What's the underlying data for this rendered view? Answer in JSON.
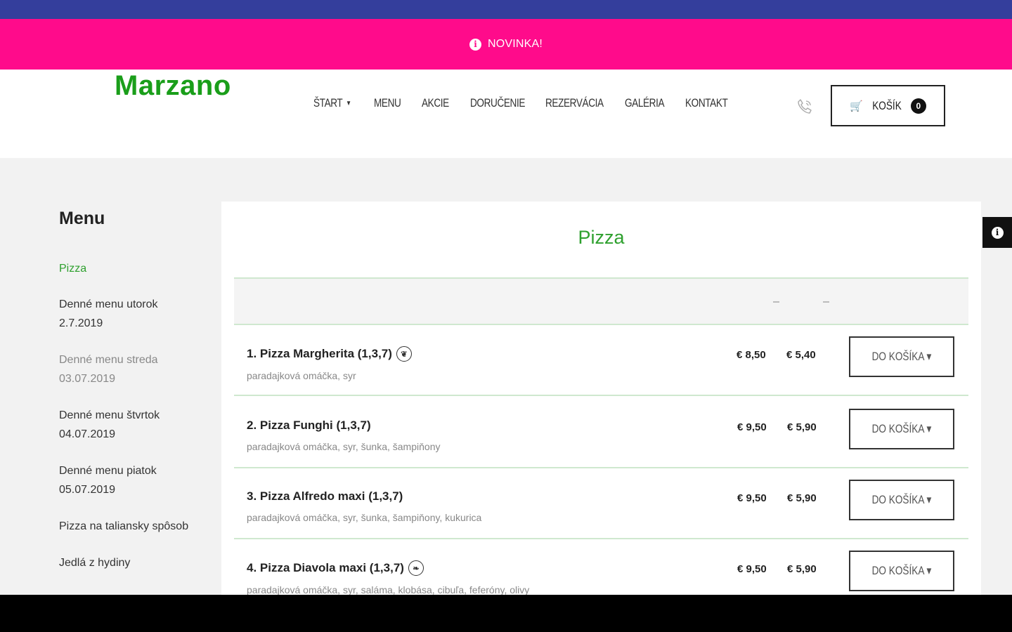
{
  "promo": {
    "icon": "info-icon",
    "text": "NOVINKA!"
  },
  "header": {
    "logo_text": "Marzano",
    "nav": [
      {
        "label": "ŠTART",
        "has_dropdown": true
      },
      {
        "label": "MENU"
      },
      {
        "label": "AKCIE"
      },
      {
        "label": "DORUČENIE"
      },
      {
        "label": "REZERVÁCIA"
      },
      {
        "label": "GALÉRIA"
      },
      {
        "label": "KONTAKT"
      }
    ],
    "phone_icon": "phone-icon",
    "cart": {
      "icon": "cart-icon",
      "label": "KOŠÍK",
      "count": "0"
    }
  },
  "sidebar": {
    "title": "Menu",
    "items": [
      {
        "label": "Pizza",
        "state": "active"
      },
      {
        "label": "Denné menu utorok 2.7.2019"
      },
      {
        "label": "Denné menu streda 03.07.2019",
        "state": "muted"
      },
      {
        "label": "Denné menu štvrtok 04.07.2019"
      },
      {
        "label": "Denné menu piatok 05.07.2019"
      },
      {
        "label": "Pizza na taliansky spôsob"
      },
      {
        "label": "Jedlá z hydiny"
      }
    ]
  },
  "panel": {
    "title": "Pizza",
    "head_dashes": [
      "-",
      "-"
    ],
    "items": [
      {
        "name": "1. Pizza Margherita (1,3,7)",
        "icon": "leaf-icon",
        "desc": "paradajková omáčka, syr",
        "price1": "€ 8,50",
        "price2": "€ 5,40",
        "button": "DO KOŠÍKA"
      },
      {
        "name": "2. Pizza Funghi (1,3,7)",
        "icon": "",
        "desc": "paradajková omáčka, syr, šunka, šampiňony",
        "price1": "€ 9,50",
        "price2": "€ 5,90",
        "button": "DO KOŠÍKA"
      },
      {
        "name": "3. Pizza Alfredo maxi (1,3,7)",
        "icon": "",
        "desc": "paradajková omáčka, syr, šunka, šampiňony, kukurica",
        "price1": "€ 9,50",
        "price2": "€ 5,90",
        "button": "DO KOŠÍKA"
      },
      {
        "name": "4. Pizza Diavola maxi (1,3,7)",
        "icon": "chili-icon",
        "desc": "paradajková omáčka, syr, saláma, klobása, cibuľa, feferóny, olivy",
        "price1": "€ 9,50",
        "price2": "€ 5,90",
        "button": "DO KOŠÍKA"
      }
    ]
  },
  "side_info_tab": {
    "icon": "info-icon"
  }
}
